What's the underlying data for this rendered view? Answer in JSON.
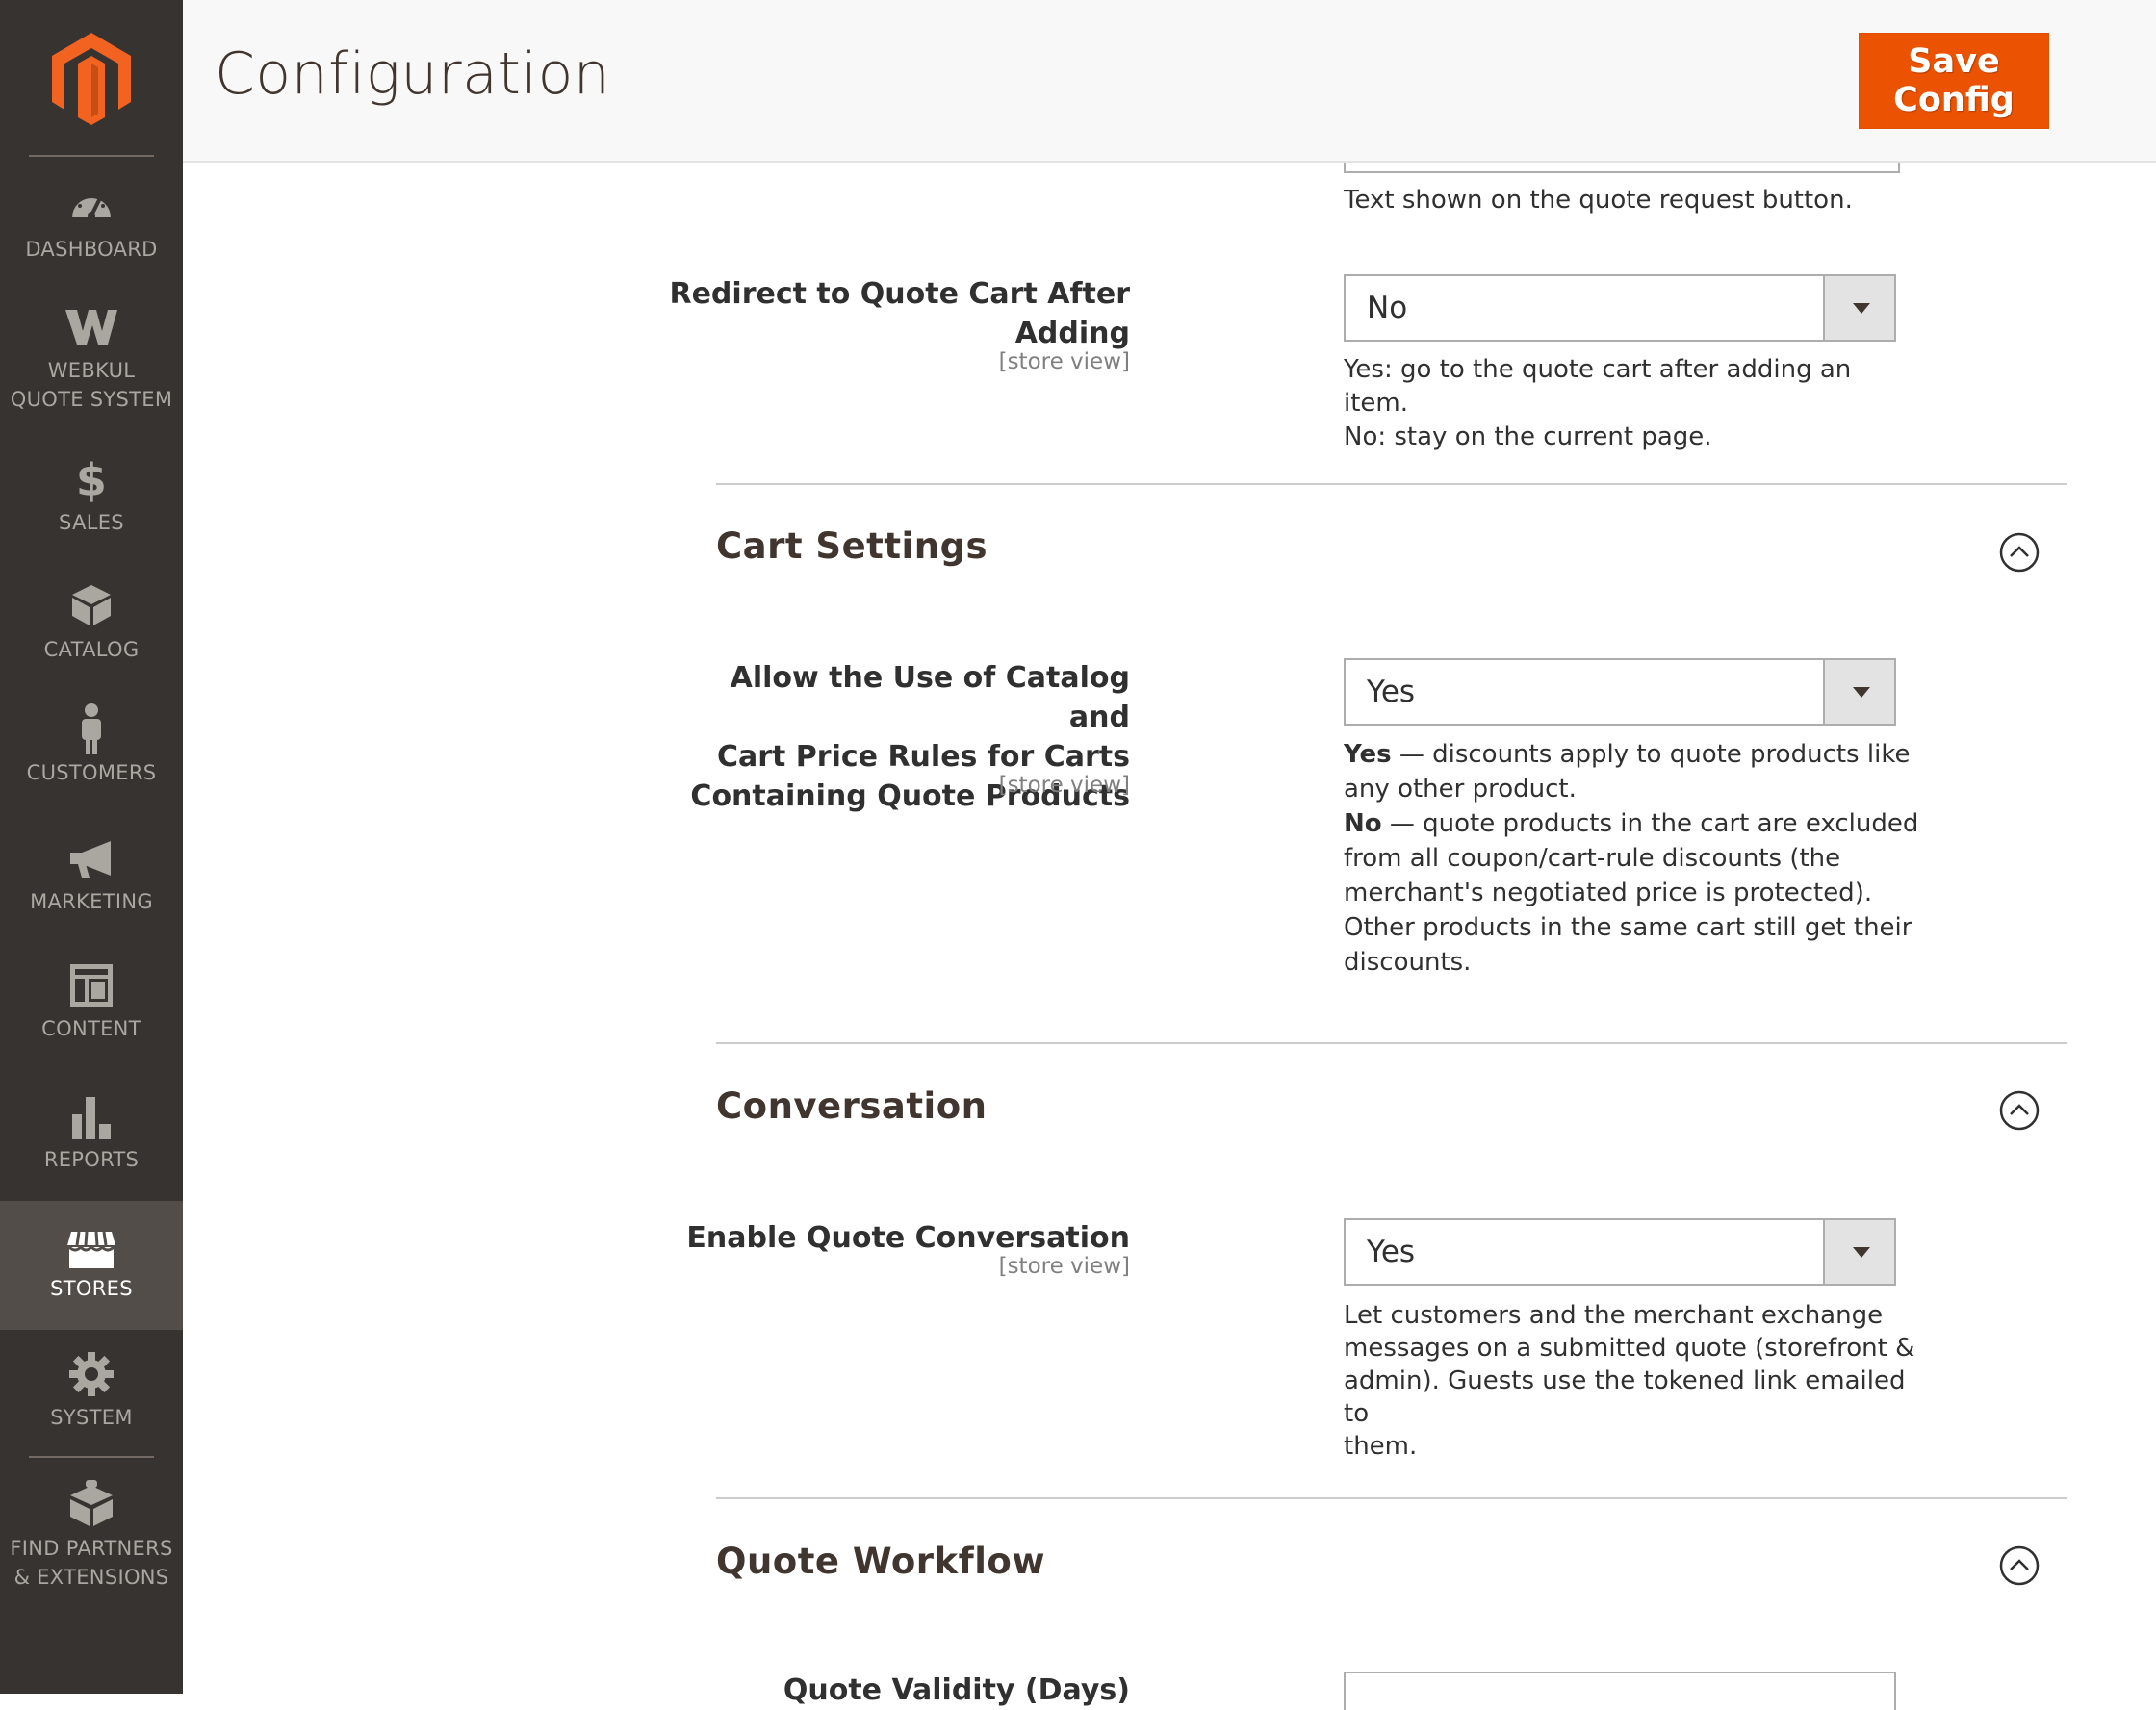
{
  "sidebar": {
    "items": [
      {
        "label": "DASHBOARD",
        "icon": "dashboard-icon"
      },
      {
        "label": "WEBKUL\nQUOTE SYSTEM",
        "icon": "webkul-icon"
      },
      {
        "label": "SALES",
        "icon": "dollar-icon"
      },
      {
        "label": "CATALOG",
        "icon": "box-icon"
      },
      {
        "label": "CUSTOMERS",
        "icon": "person-icon"
      },
      {
        "label": "MARKETING",
        "icon": "megaphone-icon"
      },
      {
        "label": "CONTENT",
        "icon": "layout-icon"
      },
      {
        "label": "REPORTS",
        "icon": "bar-chart-icon"
      },
      {
        "label": "STORES",
        "icon": "storefront-icon"
      },
      {
        "label": "SYSTEM",
        "icon": "gear-icon"
      },
      {
        "label": "FIND PARTNERS\n& EXTENSIONS",
        "icon": "blocks-icon"
      }
    ],
    "active": "STORES"
  },
  "header": {
    "title": "Configuration",
    "save_label": "Save Config"
  },
  "colors": {
    "accent": "#eb5202",
    "sidebar_bg": "#373330",
    "sidebar_active": "#524d49"
  },
  "fields": {
    "button_text_note": "Text shown on the quote request button.",
    "redirect": {
      "label_line1": "Redirect to Quote Cart After",
      "label_line2": "Adding",
      "scope": "[store view]",
      "value": "No",
      "note_line1": "Yes: go to the quote cart after adding an item.",
      "note_line2": "No: stay on the current page."
    },
    "catalog_rules": {
      "label_line1": "Allow the Use of Catalog and",
      "label_line2": "Cart Price Rules for Carts",
      "label_line3": "Containing Quote Products",
      "scope": "[store view]",
      "value": "Yes",
      "note_yes_strong": "Yes",
      "note_yes_line1": " — discounts apply to quote products like",
      "note_yes_line2": "any other product.",
      "note_no_strong": "No",
      "note_no_line1": " — quote products in the cart are excluded",
      "note_no_line2": "from all coupon/cart-rule discounts (the",
      "note_no_line3": "merchant's negotiated price is protected).",
      "note_no_line4": "Other products in the same cart still get their",
      "note_no_line5": "discounts."
    },
    "conversation": {
      "label": "Enable Quote Conversation",
      "scope": "[store view]",
      "value": "Yes",
      "note_line1": "Let customers and the merchant exchange",
      "note_line2": "messages on a submitted quote (storefront &",
      "note_line3": "admin). Guests use the tokened link emailed to",
      "note_line4": "them."
    },
    "validity": {
      "label": "Quote Validity (Days)"
    }
  },
  "sections": {
    "cart_settings": "Cart Settings",
    "conversation": "Conversation",
    "quote_workflow": "Quote Workflow"
  }
}
